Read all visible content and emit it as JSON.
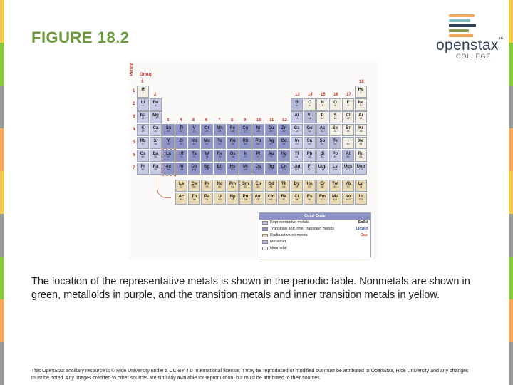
{
  "slide": {
    "title": "FIGURE 18.2",
    "caption": "The location of the representative metals is shown in the periodic table. Nonmetals are shown in green, metalloids in purple, and the transition metals and inner transition metals in yellow.",
    "footer": "This OpenStax ancillary resource is © Rice University under a CC-BY 4.0 International license; it may be reproduced or modified but must be attributed to OpenStax, Rice University and any changes must be noted. Any images credited to other sources are similarly available for reproduction, but must be attributed to their sources."
  },
  "logo": {
    "word_open": "open",
    "word_stax": "stax",
    "tm": "™",
    "sub": "COLLEGE",
    "bar_colors": [
      "#f2a65a",
      "#7dc0c6",
      "#2f4158",
      "#8a9d4f",
      "#f2a65a"
    ]
  },
  "edge_colors": [
    "#f2c94c",
    "#8dc63f",
    "#999999",
    "#f2a65a",
    "#f2c94c",
    "#999999",
    "#8dc63f",
    "#f2a65a",
    "#999999"
  ],
  "figure": {
    "period_label": "Period",
    "group_label": "Group",
    "period_numbers": [
      "1",
      "2",
      "3",
      "4",
      "5",
      "6",
      "7"
    ],
    "group_numbers": [
      "1",
      "2",
      "3",
      "4",
      "5",
      "6",
      "7",
      "8",
      "9",
      "10",
      "11",
      "12",
      "13",
      "14",
      "15",
      "16",
      "17",
      "18"
    ],
    "colors": {
      "representative": "#c9cbe6",
      "transition": "#8f95c8",
      "radioactive": "#e9d9b0",
      "metalloid": "#b6b9d8",
      "nonmetal": "#f3efe3",
      "border": "#9aa3b8"
    },
    "elements": [
      {
        "symbol": "H",
        "number": "1",
        "period": 1,
        "group": 1,
        "cat": "nonmetal"
      },
      {
        "symbol": "He",
        "number": "2",
        "period": 1,
        "group": 18,
        "cat": "nonmetal"
      },
      {
        "symbol": "Li",
        "number": "3",
        "period": 2,
        "group": 1,
        "cat": "representative"
      },
      {
        "symbol": "Be",
        "number": "4",
        "period": 2,
        "group": 2,
        "cat": "representative"
      },
      {
        "symbol": "B",
        "number": "5",
        "period": 2,
        "group": 13,
        "cat": "metalloid"
      },
      {
        "symbol": "C",
        "number": "6",
        "period": 2,
        "group": 14,
        "cat": "nonmetal"
      },
      {
        "symbol": "N",
        "number": "7",
        "period": 2,
        "group": 15,
        "cat": "nonmetal"
      },
      {
        "symbol": "O",
        "number": "8",
        "period": 2,
        "group": 16,
        "cat": "nonmetal"
      },
      {
        "symbol": "F",
        "number": "9",
        "period": 2,
        "group": 17,
        "cat": "nonmetal"
      },
      {
        "symbol": "Ne",
        "number": "10",
        "period": 2,
        "group": 18,
        "cat": "nonmetal"
      },
      {
        "symbol": "Na",
        "number": "11",
        "period": 3,
        "group": 1,
        "cat": "representative"
      },
      {
        "symbol": "Mg",
        "number": "12",
        "period": 3,
        "group": 2,
        "cat": "representative"
      },
      {
        "symbol": "Al",
        "number": "13",
        "period": 3,
        "group": 13,
        "cat": "representative"
      },
      {
        "symbol": "Si",
        "number": "14",
        "period": 3,
        "group": 14,
        "cat": "metalloid"
      },
      {
        "symbol": "P",
        "number": "15",
        "period": 3,
        "group": 15,
        "cat": "nonmetal"
      },
      {
        "symbol": "S",
        "number": "16",
        "period": 3,
        "group": 16,
        "cat": "nonmetal"
      },
      {
        "symbol": "Cl",
        "number": "17",
        "period": 3,
        "group": 17,
        "cat": "nonmetal"
      },
      {
        "symbol": "Ar",
        "number": "18",
        "period": 3,
        "group": 18,
        "cat": "nonmetal"
      },
      {
        "symbol": "K",
        "number": "19",
        "period": 4,
        "group": 1,
        "cat": "representative"
      },
      {
        "symbol": "Ca",
        "number": "20",
        "period": 4,
        "group": 2,
        "cat": "representative"
      },
      {
        "symbol": "Sc",
        "number": "21",
        "period": 4,
        "group": 3,
        "cat": "transition"
      },
      {
        "symbol": "Ti",
        "number": "22",
        "period": 4,
        "group": 4,
        "cat": "transition"
      },
      {
        "symbol": "V",
        "number": "23",
        "period": 4,
        "group": 5,
        "cat": "transition"
      },
      {
        "symbol": "Cr",
        "number": "24",
        "period": 4,
        "group": 6,
        "cat": "transition"
      },
      {
        "symbol": "Mn",
        "number": "25",
        "period": 4,
        "group": 7,
        "cat": "transition"
      },
      {
        "symbol": "Fe",
        "number": "26",
        "period": 4,
        "group": 8,
        "cat": "transition"
      },
      {
        "symbol": "Co",
        "number": "27",
        "period": 4,
        "group": 9,
        "cat": "transition"
      },
      {
        "symbol": "Ni",
        "number": "28",
        "period": 4,
        "group": 10,
        "cat": "transition"
      },
      {
        "symbol": "Cu",
        "number": "29",
        "period": 4,
        "group": 11,
        "cat": "transition"
      },
      {
        "symbol": "Zn",
        "number": "30",
        "period": 4,
        "group": 12,
        "cat": "transition"
      },
      {
        "symbol": "Ga",
        "number": "31",
        "period": 4,
        "group": 13,
        "cat": "representative"
      },
      {
        "symbol": "Ge",
        "number": "32",
        "period": 4,
        "group": 14,
        "cat": "metalloid"
      },
      {
        "symbol": "As",
        "number": "33",
        "period": 4,
        "group": 15,
        "cat": "metalloid"
      },
      {
        "symbol": "Se",
        "number": "34",
        "period": 4,
        "group": 16,
        "cat": "nonmetal"
      },
      {
        "symbol": "Br",
        "number": "35",
        "period": 4,
        "group": 17,
        "cat": "nonmetal"
      },
      {
        "symbol": "Kr",
        "number": "36",
        "period": 4,
        "group": 18,
        "cat": "nonmetal"
      },
      {
        "symbol": "Rb",
        "number": "37",
        "period": 5,
        "group": 1,
        "cat": "representative"
      },
      {
        "symbol": "Sr",
        "number": "38",
        "period": 5,
        "group": 2,
        "cat": "representative"
      },
      {
        "symbol": "Y",
        "number": "39",
        "period": 5,
        "group": 3,
        "cat": "transition"
      },
      {
        "symbol": "Zr",
        "number": "40",
        "period": 5,
        "group": 4,
        "cat": "transition"
      },
      {
        "symbol": "Nb",
        "number": "41",
        "period": 5,
        "group": 5,
        "cat": "transition"
      },
      {
        "symbol": "Mo",
        "number": "42",
        "period": 5,
        "group": 6,
        "cat": "transition"
      },
      {
        "symbol": "Tc",
        "number": "43",
        "period": 5,
        "group": 7,
        "cat": "transition"
      },
      {
        "symbol": "Ru",
        "number": "44",
        "period": 5,
        "group": 8,
        "cat": "transition"
      },
      {
        "symbol": "Rh",
        "number": "45",
        "period": 5,
        "group": 9,
        "cat": "transition"
      },
      {
        "symbol": "Pd",
        "number": "46",
        "period": 5,
        "group": 10,
        "cat": "transition"
      },
      {
        "symbol": "Ag",
        "number": "47",
        "period": 5,
        "group": 11,
        "cat": "transition"
      },
      {
        "symbol": "Cd",
        "number": "48",
        "period": 5,
        "group": 12,
        "cat": "transition"
      },
      {
        "symbol": "In",
        "number": "49",
        "period": 5,
        "group": 13,
        "cat": "representative"
      },
      {
        "symbol": "Sn",
        "number": "50",
        "period": 5,
        "group": 14,
        "cat": "representative"
      },
      {
        "symbol": "Sb",
        "number": "51",
        "period": 5,
        "group": 15,
        "cat": "metalloid"
      },
      {
        "symbol": "Te",
        "number": "52",
        "period": 5,
        "group": 16,
        "cat": "metalloid"
      },
      {
        "symbol": "I",
        "number": "53",
        "period": 5,
        "group": 17,
        "cat": "nonmetal"
      },
      {
        "symbol": "Xe",
        "number": "54",
        "period": 5,
        "group": 18,
        "cat": "nonmetal"
      },
      {
        "symbol": "Cs",
        "number": "55",
        "period": 6,
        "group": 1,
        "cat": "representative"
      },
      {
        "symbol": "Ba",
        "number": "56",
        "period": 6,
        "group": 2,
        "cat": "representative"
      },
      {
        "symbol": "La",
        "number": "57",
        "period": 6,
        "group": 3,
        "cat": "transition"
      },
      {
        "symbol": "Hf",
        "number": "72",
        "period": 6,
        "group": 4,
        "cat": "transition"
      },
      {
        "symbol": "Ta",
        "number": "73",
        "period": 6,
        "group": 5,
        "cat": "transition"
      },
      {
        "symbol": "W",
        "number": "74",
        "period": 6,
        "group": 6,
        "cat": "transition"
      },
      {
        "symbol": "Re",
        "number": "75",
        "period": 6,
        "group": 7,
        "cat": "transition"
      },
      {
        "symbol": "Os",
        "number": "76",
        "period": 6,
        "group": 8,
        "cat": "transition"
      },
      {
        "symbol": "Ir",
        "number": "77",
        "period": 6,
        "group": 9,
        "cat": "transition"
      },
      {
        "symbol": "Pt",
        "number": "78",
        "period": 6,
        "group": 10,
        "cat": "transition"
      },
      {
        "symbol": "Au",
        "number": "79",
        "period": 6,
        "group": 11,
        "cat": "transition"
      },
      {
        "symbol": "Hg",
        "number": "80",
        "period": 6,
        "group": 12,
        "cat": "transition"
      },
      {
        "symbol": "Tl",
        "number": "81",
        "period": 6,
        "group": 13,
        "cat": "representative"
      },
      {
        "symbol": "Pb",
        "number": "82",
        "period": 6,
        "group": 14,
        "cat": "representative"
      },
      {
        "symbol": "Bi",
        "number": "83",
        "period": 6,
        "group": 15,
        "cat": "representative"
      },
      {
        "symbol": "Po",
        "number": "84",
        "period": 6,
        "group": 16,
        "cat": "representative"
      },
      {
        "symbol": "At",
        "number": "85",
        "period": 6,
        "group": 17,
        "cat": "metalloid"
      },
      {
        "symbol": "Rn",
        "number": "86",
        "period": 6,
        "group": 18,
        "cat": "nonmetal"
      },
      {
        "symbol": "Fr",
        "number": "87",
        "period": 7,
        "group": 1,
        "cat": "representative"
      },
      {
        "symbol": "Ra",
        "number": "88",
        "period": 7,
        "group": 2,
        "cat": "representative"
      },
      {
        "symbol": "Ac",
        "number": "89",
        "period": 7,
        "group": 3,
        "cat": "transition"
      },
      {
        "symbol": "Rf",
        "number": "104",
        "period": 7,
        "group": 4,
        "cat": "transition"
      },
      {
        "symbol": "Db",
        "number": "105",
        "period": 7,
        "group": 5,
        "cat": "transition"
      },
      {
        "symbol": "Sg",
        "number": "106",
        "period": 7,
        "group": 6,
        "cat": "transition"
      },
      {
        "symbol": "Bh",
        "number": "107",
        "period": 7,
        "group": 7,
        "cat": "transition"
      },
      {
        "symbol": "Hs",
        "number": "108",
        "period": 7,
        "group": 8,
        "cat": "transition"
      },
      {
        "symbol": "Mt",
        "number": "109",
        "period": 7,
        "group": 9,
        "cat": "transition"
      },
      {
        "symbol": "Ds",
        "number": "110",
        "period": 7,
        "group": 10,
        "cat": "transition"
      },
      {
        "symbol": "Rg",
        "number": "111",
        "period": 7,
        "group": 11,
        "cat": "transition"
      },
      {
        "symbol": "Cn",
        "number": "112",
        "period": 7,
        "group": 12,
        "cat": "transition"
      },
      {
        "symbol": "Uut",
        "number": "113",
        "period": 7,
        "group": 13,
        "cat": "representative"
      },
      {
        "symbol": "Fl",
        "number": "114",
        "period": 7,
        "group": 14,
        "cat": "representative"
      },
      {
        "symbol": "Uup",
        "number": "115",
        "period": 7,
        "group": 15,
        "cat": "representative"
      },
      {
        "symbol": "Lv",
        "number": "116",
        "period": 7,
        "group": 16,
        "cat": "representative"
      },
      {
        "symbol": "Uus",
        "number": "117",
        "period": 7,
        "group": 17,
        "cat": "representative"
      },
      {
        "symbol": "Uuo",
        "number": "118",
        "period": 7,
        "group": 18,
        "cat": "representative"
      }
    ],
    "lanthanides": [
      {
        "symbol": "La",
        "number": "57"
      },
      {
        "symbol": "Ce",
        "number": "58"
      },
      {
        "symbol": "Pr",
        "number": "59"
      },
      {
        "symbol": "Nd",
        "number": "60"
      },
      {
        "symbol": "Pm",
        "number": "61"
      },
      {
        "symbol": "Sm",
        "number": "62"
      },
      {
        "symbol": "Eu",
        "number": "63"
      },
      {
        "symbol": "Gd",
        "number": "64"
      },
      {
        "symbol": "Tb",
        "number": "65"
      },
      {
        "symbol": "Dy",
        "number": "66"
      },
      {
        "symbol": "Ho",
        "number": "67"
      },
      {
        "symbol": "Er",
        "number": "68"
      },
      {
        "symbol": "Tm",
        "number": "69"
      },
      {
        "symbol": "Yb",
        "number": "70"
      },
      {
        "symbol": "Lu",
        "number": "71"
      }
    ],
    "actinides": [
      {
        "symbol": "Ac",
        "number": "89"
      },
      {
        "symbol": "Th",
        "number": "90"
      },
      {
        "symbol": "Pa",
        "number": "91"
      },
      {
        "symbol": "U",
        "number": "92"
      },
      {
        "symbol": "Np",
        "number": "93"
      },
      {
        "symbol": "Pu",
        "number": "94"
      },
      {
        "symbol": "Am",
        "number": "95"
      },
      {
        "symbol": "Cm",
        "number": "96"
      },
      {
        "symbol": "Bk",
        "number": "97"
      },
      {
        "symbol": "Cf",
        "number": "98"
      },
      {
        "symbol": "Es",
        "number": "99"
      },
      {
        "symbol": "Fm",
        "number": "100"
      },
      {
        "symbol": "Md",
        "number": "101"
      },
      {
        "symbol": "No",
        "number": "102"
      },
      {
        "symbol": "Lr",
        "number": "103"
      }
    ],
    "legend": {
      "title": "Color Code",
      "rows": [
        {
          "label": "Representative metals",
          "state": "Solid",
          "state_color": "#222222",
          "swatch": "representative"
        },
        {
          "label": "Transition and inner transition metals",
          "state": "Liquid",
          "state_color": "#3a5bb5",
          "swatch": "transition"
        },
        {
          "label": "Radioactive elements",
          "state": "Gas",
          "state_color": "#c0392b",
          "swatch": "radioactive"
        },
        {
          "label": "Metalloid",
          "state": "",
          "state_color": "#222222",
          "swatch": "metalloid"
        },
        {
          "label": "Nonmetal",
          "state": "",
          "state_color": "#222222",
          "swatch": "nonmetal"
        }
      ]
    }
  }
}
